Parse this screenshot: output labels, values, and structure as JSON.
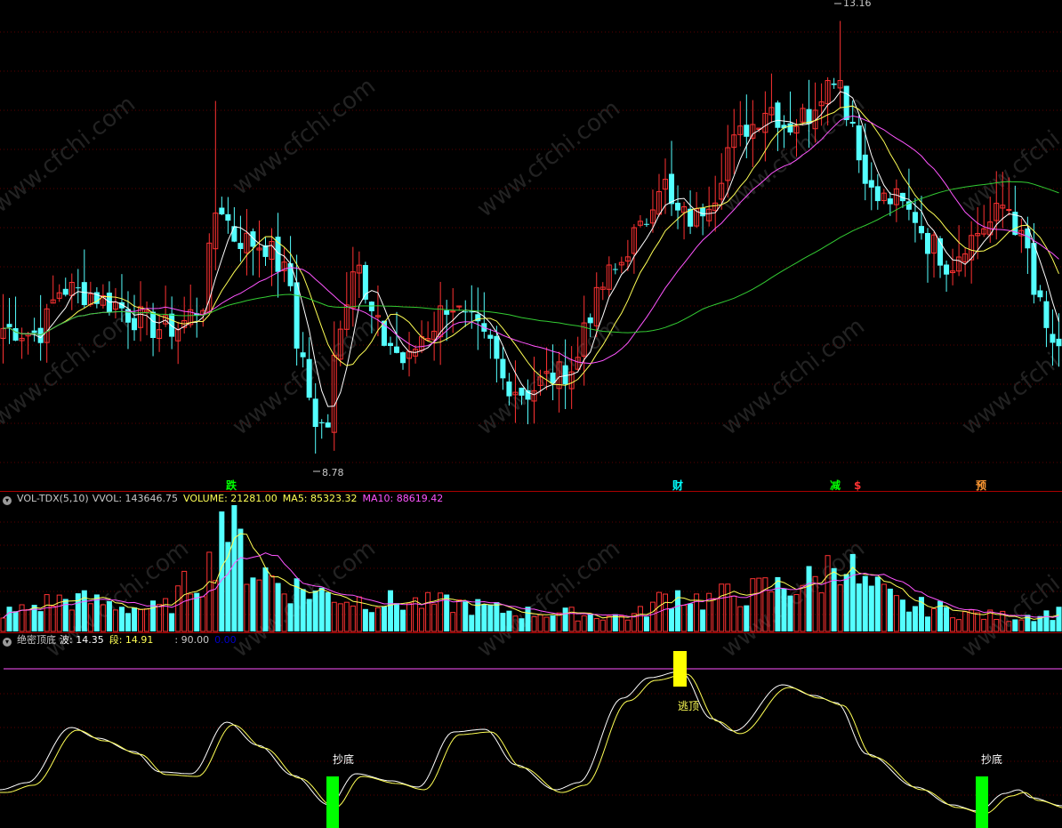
{
  "colors": {
    "background": "#000000",
    "up": "#ff3232",
    "down": "#54ffff",
    "ma5": "#ffffff",
    "ma10": "#ffff55",
    "ma20": "#ff55ff",
    "ma60": "#33cc33",
    "separator": "#aa0000",
    "vol_ma5": "#ffff55",
    "vol_ma10": "#ff55ff",
    "osc_wave": "#ffffff",
    "osc_seg": "#ffff55",
    "osc_line": "#ff55ff",
    "signal_buy": "#00ff00",
    "signal_sell": "#ffff00",
    "label_blue": "#0000cc"
  },
  "price_panel": {
    "high_label": "13.16",
    "low_label": "8.78",
    "event_markers": [
      {
        "text": "跌",
        "color": "#00ff00"
      },
      {
        "text": "财",
        "color": "#00ffff"
      },
      {
        "text": "减",
        "color": "#00ff00"
      },
      {
        "text": "$",
        "color": "#ff3232"
      },
      {
        "text": "预",
        "color": "#ff9933"
      }
    ]
  },
  "volume_panel": {
    "indicator": "VOL-TDX(5,10)",
    "vvol": "VVOL: 143646.75",
    "volume": "VOLUME: 21281.00",
    "ma5": "MA5: 85323.32",
    "ma10": "MA10: 88619.42"
  },
  "osc_panel": {
    "indicator": "绝密顶底",
    "wave": "波: 14.35",
    "seg": "段: 14.91",
    "level": ": 90.00",
    "extra": "0.00",
    "buy_label": "抄底",
    "sell_label": "逃顶"
  },
  "watermark": "www.cfchi.com",
  "chart_data": {
    "type": "candlestick",
    "panels": [
      "price",
      "volume",
      "oscillator"
    ],
    "price_range": [
      8.78,
      13.16
    ],
    "series": [
      {
        "name": "MA5"
      },
      {
        "name": "MA10"
      },
      {
        "name": "MA20"
      },
      {
        "name": "MA60"
      }
    ],
    "volume_last": 21281.0,
    "volume_ma5": 85323.32,
    "volume_ma10": 88619.42,
    "osc_wave": 14.35,
    "osc_seg": 14.91,
    "osc_level": 90.0
  }
}
